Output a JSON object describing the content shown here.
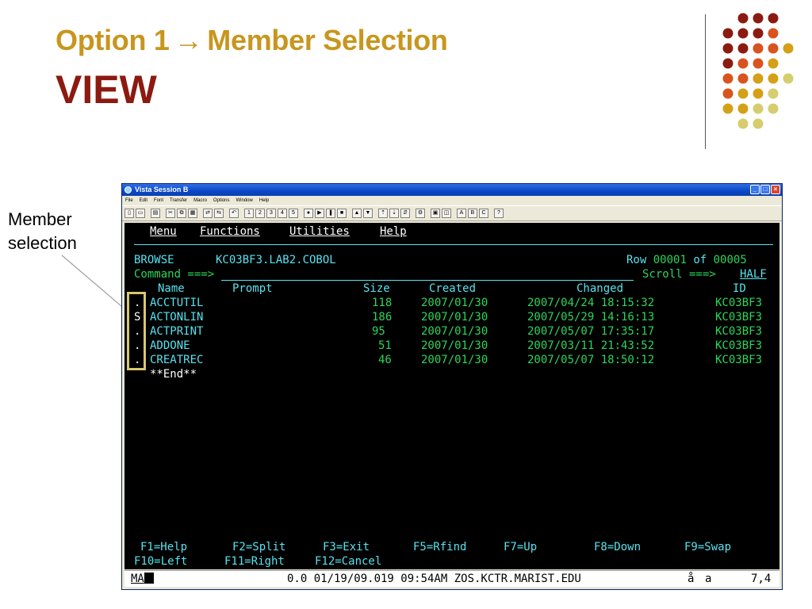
{
  "slide": {
    "title_part1": "Option 1",
    "title_arrow": "→",
    "title_part2": "Member Selection",
    "subtitle": "VIEW",
    "callout_line1": "Member",
    "callout_line2": "selection"
  },
  "colors": {
    "title": "#c8961e",
    "subtitle": "#8b1a10",
    "dots": [
      "#8b1a10",
      "#d9531e",
      "#d4a017",
      "#d6cd6e"
    ]
  },
  "window": {
    "title": "Vista Session B",
    "menu": [
      "File",
      "Edit",
      "Font",
      "Transfer",
      "Macro",
      "Options",
      "Window",
      "Help"
    ]
  },
  "terminal": {
    "menu": [
      "Menu",
      "Functions",
      "Utilities",
      "Help"
    ],
    "mode": "BROWSE",
    "dataset": "KC03BF3.LAB2.COBOL",
    "row_label": "Row",
    "row_value": "00001",
    "of_label": "of",
    "of_value": "00005",
    "command_label": "Command ===>",
    "scroll_label": "Scroll ===>",
    "scroll_value": "HALF",
    "headers": {
      "name": "Name",
      "prompt": "Prompt",
      "size": "Size",
      "created": "Created",
      "changed": "Changed",
      "id": "ID"
    },
    "members": [
      {
        "sel": ".",
        "name": "ACCTUTIL",
        "size": "118",
        "created": "2007/01/30",
        "changed": "2007/04/24 18:15:32",
        "id": "KC03BF3"
      },
      {
        "sel": "S",
        "name": "ACTONLIN",
        "size": "186",
        "created": "2007/01/30",
        "changed": "2007/05/29 14:16:13",
        "id": "KC03BF3"
      },
      {
        "sel": ".",
        "name": "ACTPRINT",
        "size": "95",
        "created": "2007/01/30",
        "changed": "2007/05/07 17:35:17",
        "id": "KC03BF3"
      },
      {
        "sel": ".",
        "name": "ADDONE",
        "size": "51",
        "created": "2007/01/30",
        "changed": "2007/03/11 21:43:52",
        "id": "KC03BF3"
      },
      {
        "sel": ".",
        "name": "CREATREC",
        "size": "46",
        "created": "2007/01/30",
        "changed": "2007/05/07 18:50:12",
        "id": "KC03BF3"
      }
    ],
    "end_marker": "**End**",
    "fkeys_row1": [
      "F1=Help",
      "F2=Split",
      "F3=Exit",
      "F5=Rfind",
      "F7=Up",
      "F8=Down",
      "F9=Swap"
    ],
    "fkeys_row2": [
      "F10=Left",
      "F11=Right",
      "F12=Cancel"
    ]
  },
  "status": {
    "mode": "MA",
    "info": "0.0 01/19/09.019 09:54AM ZOS.KCTR.MARIST.EDU",
    "user_glyph": "å",
    "session": "a",
    "cursor_pos": "7,4"
  }
}
